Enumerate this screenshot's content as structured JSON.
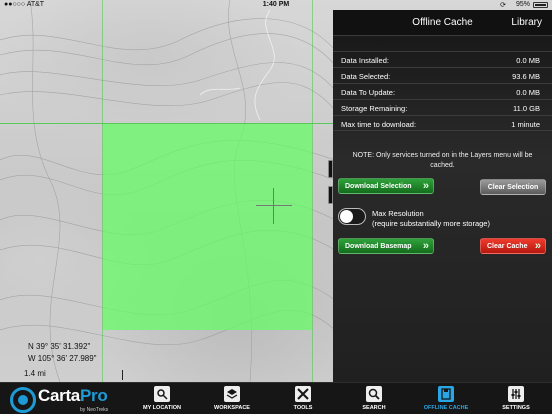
{
  "status_bar": {
    "carrier": "●●○○○ AT&T",
    "time": "1:40 PM",
    "battery": "95%"
  },
  "map": {
    "coordinates": [
      "N 39° 35' 31.392\"",
      "W 105° 36' 27.989\""
    ],
    "scale": "1.4 mi"
  },
  "panel": {
    "title": "Offline Cache",
    "library": "Library",
    "stats": [
      {
        "key": "Data Installed:",
        "value": "0.0 MB"
      },
      {
        "key": "Data Selected:",
        "value": "93.6 MB"
      },
      {
        "key": "Data To Update:",
        "value": "0.0 MB"
      },
      {
        "key": "Storage Remaining:",
        "value": "11.0 GB"
      },
      {
        "key": "Max time to download:",
        "value": "1 minute"
      }
    ],
    "note": "NOTE: Only services turned on in the Layers menu will be cached.",
    "download_selection": "Download Selection",
    "clear_selection": "Clear Selection",
    "max_resolution": "Max Resolution",
    "max_resolution_hint": "(require substantially more storage)",
    "download_basemap": "Download Basemap",
    "clear_cache": "Clear Cache"
  },
  "tabbar": {
    "brand_carta": "Carta",
    "brand_pro": "Pro",
    "brand_by": "by NeoTreks",
    "tabs": [
      {
        "label": "MY LOCATION",
        "icon": "location-icon"
      },
      {
        "label": "WORKSPACE",
        "icon": "layers-icon"
      },
      {
        "label": "TOOLS",
        "icon": "tools-icon"
      },
      {
        "label": "SEARCH",
        "icon": "search-icon"
      },
      {
        "label": "OFFLINE CACHE",
        "icon": "offline-cache-icon",
        "active": true
      },
      {
        "label": "SETTINGS",
        "icon": "settings-icon"
      }
    ]
  }
}
